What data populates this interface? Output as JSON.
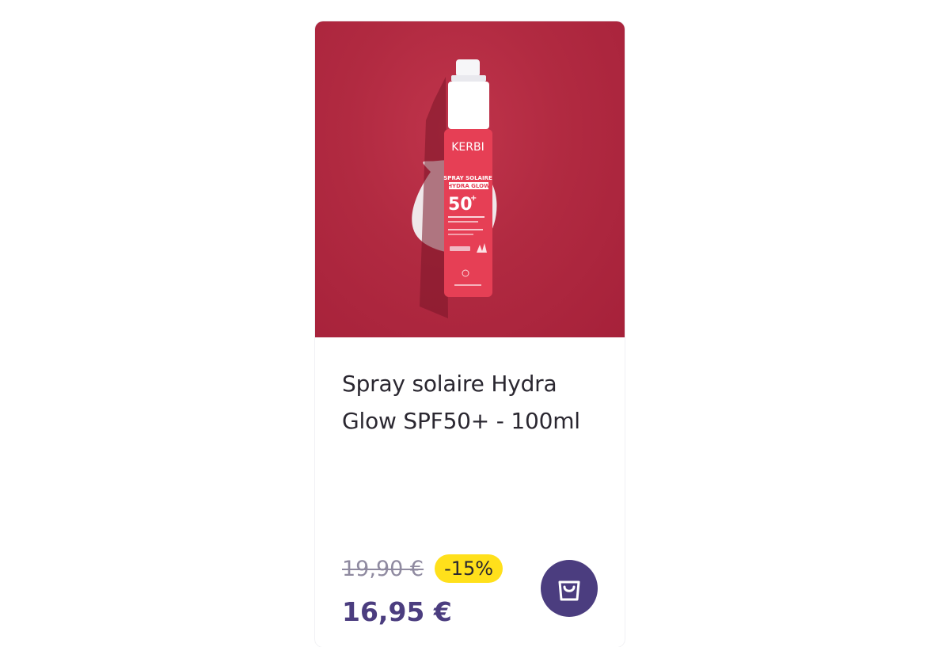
{
  "product": {
    "name": "Spray solaire Hydra Glow SPF50+ - 100ml",
    "image_alt": "Spray solaire Hydra Glow",
    "packaging": {
      "brand": "KERBI",
      "line1": "SPRAY SOLAIRE",
      "line2": "HYDRA GLOW",
      "spf": "50",
      "spf_sup": "+"
    },
    "old_price": "19,90 €",
    "discount": "-15%",
    "price": "16,95 €"
  },
  "colors": {
    "accent": "#4b3d7f",
    "discount_bg": "#ffe01b",
    "photo_bg": "#b12a41"
  },
  "icons": {
    "cart": "shopping-bag-icon"
  }
}
